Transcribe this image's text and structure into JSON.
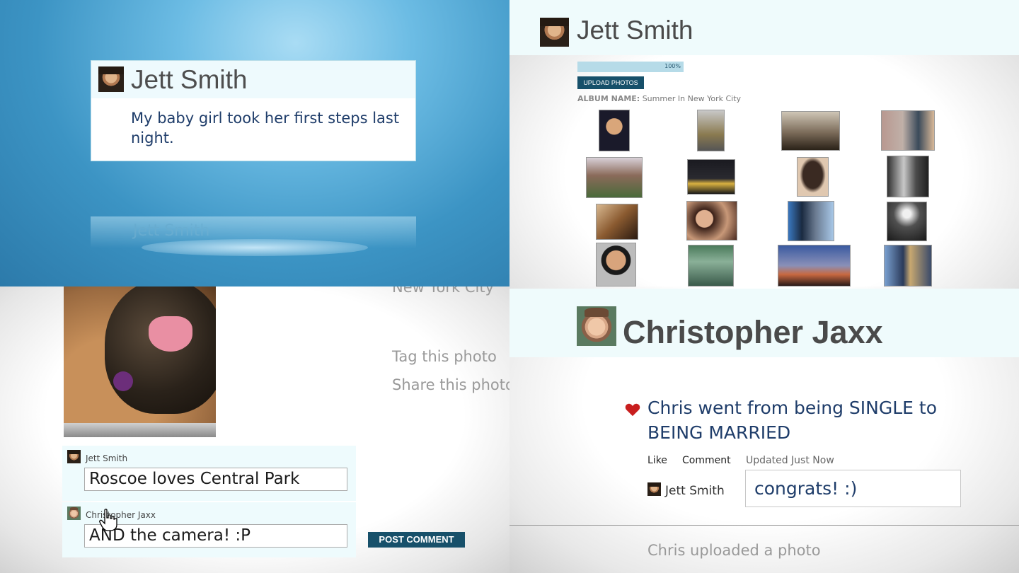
{
  "q1": {
    "author": "Jett Smith",
    "post_text": "My baby girl took her first steps last night."
  },
  "q2": {
    "author": "Jett Smith",
    "progress_label": "100%",
    "progress": 1.0,
    "upload_button": "UPLOAD PHOTOS",
    "album_label": "ALBUM NAME:",
    "album_name": "Summer In New York City"
  },
  "q3": {
    "caption_fragment": "New York City",
    "tag_link": "Tag this photo",
    "share_link": "Share this photo",
    "comments": [
      {
        "user": "Jett Smith",
        "text": "Roscoe loves Central Park"
      },
      {
        "user": "Christopher Jaxx",
        "text": "AND the camera!  :P"
      }
    ],
    "post_button": "POST COMMENT"
  },
  "q4": {
    "profile_name": "Christopher Jaxx",
    "status_text": "Chris went from being SINGLE to BEING MARRIED",
    "like_label": "Like",
    "comment_label": "Comment",
    "updated_text": "Updated Just Now",
    "commenter": "Jett Smith",
    "comment_text": "congrats! :)",
    "feed_item": "Chris uploaded a photo"
  },
  "colors": {
    "accent_dark_teal": "#17506a",
    "header_tint": "#effbfc",
    "status_text": "#1f3d6a",
    "heart": "#c81e1e"
  },
  "icons": [
    "heart-icon",
    "hand-cursor-icon"
  ]
}
